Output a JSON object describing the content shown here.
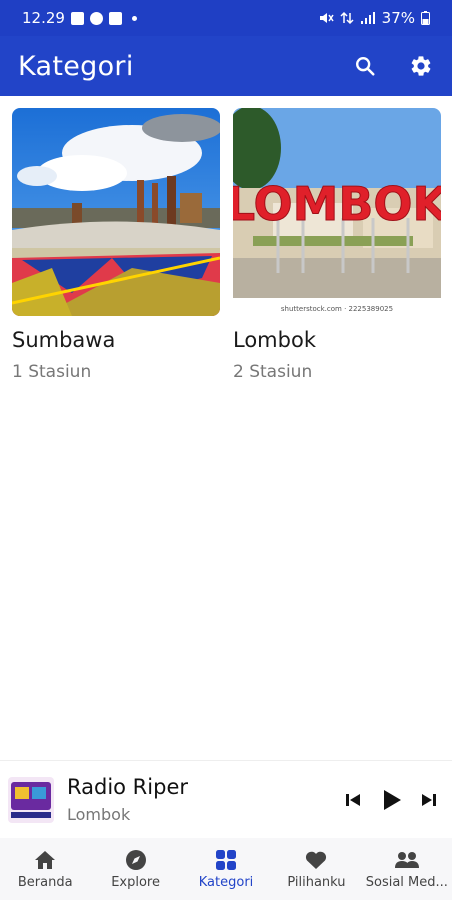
{
  "status_bar": {
    "time": "12.29",
    "battery": "37%"
  },
  "app_bar": {
    "title": "Kategori",
    "search_icon": "search-icon",
    "settings_icon": "gear-icon"
  },
  "categories": [
    {
      "title": "Sumbawa",
      "subtitle": "1 Stasiun"
    },
    {
      "title": "Lombok",
      "subtitle": "2 Stasiun",
      "image_sign_text": "LOMBOK",
      "image_caption": "shutterstock.com · 2225389025"
    }
  ],
  "mini_player": {
    "title": "Radio Riper",
    "subtitle": "Lombok"
  },
  "bottom_nav": {
    "items": [
      {
        "label": "Beranda",
        "icon": "home-icon",
        "active": false
      },
      {
        "label": "Explore",
        "icon": "compass-icon",
        "active": false
      },
      {
        "label": "Kategori",
        "icon": "grid-icon",
        "active": true
      },
      {
        "label": "Pilihanku",
        "icon": "heart-icon",
        "active": false
      },
      {
        "label": "Sosial Med...",
        "icon": "people-icon",
        "active": false
      }
    ]
  },
  "colors": {
    "primary": "#2244c8",
    "status_bar": "#1f3fc4",
    "active_nav": "#2244c8"
  }
}
